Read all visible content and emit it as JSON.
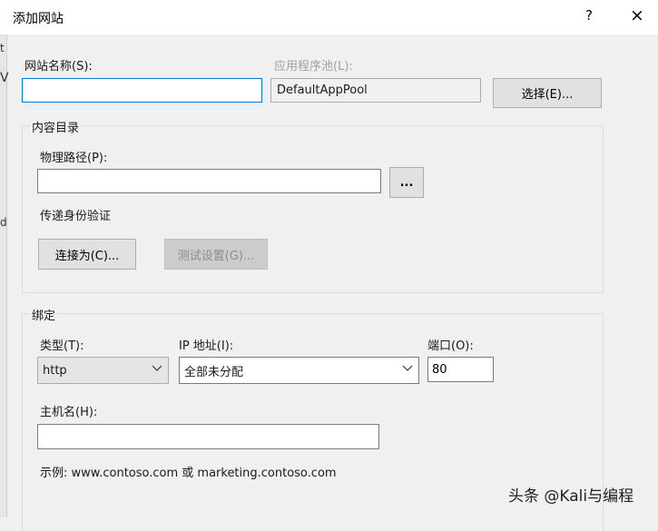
{
  "window": {
    "title": "添加网站",
    "help_label": "?",
    "close_label": "×"
  },
  "site_name": {
    "label": "网站名称(S):",
    "value": ""
  },
  "app_pool": {
    "label": "应用程序池(L):",
    "value": "DefaultAppPool",
    "select_button": "选择(E)..."
  },
  "content_dir": {
    "group_title": "内容目录",
    "physical_path_label": "物理路径(P):",
    "physical_path_value": "",
    "browse_button": "...",
    "passthrough_label": "传递身份验证",
    "connect_as_button": "连接为(C)...",
    "test_settings_button": "测试设置(G)..."
  },
  "binding": {
    "group_title": "绑定",
    "type_label": "类型(T):",
    "type_value": "http",
    "ip_label": "IP 地址(I):",
    "ip_value": "全部未分配",
    "port_label": "端口(O):",
    "port_value": "80",
    "hostname_label": "主机名(H):",
    "hostname_value": "",
    "example_text": "示例: www.contoso.com 或 marketing.contoso.com"
  },
  "background_window": {
    "glyphs": [
      "t",
      "V",
      "d"
    ]
  },
  "watermark": "头条 @Kali与编程"
}
